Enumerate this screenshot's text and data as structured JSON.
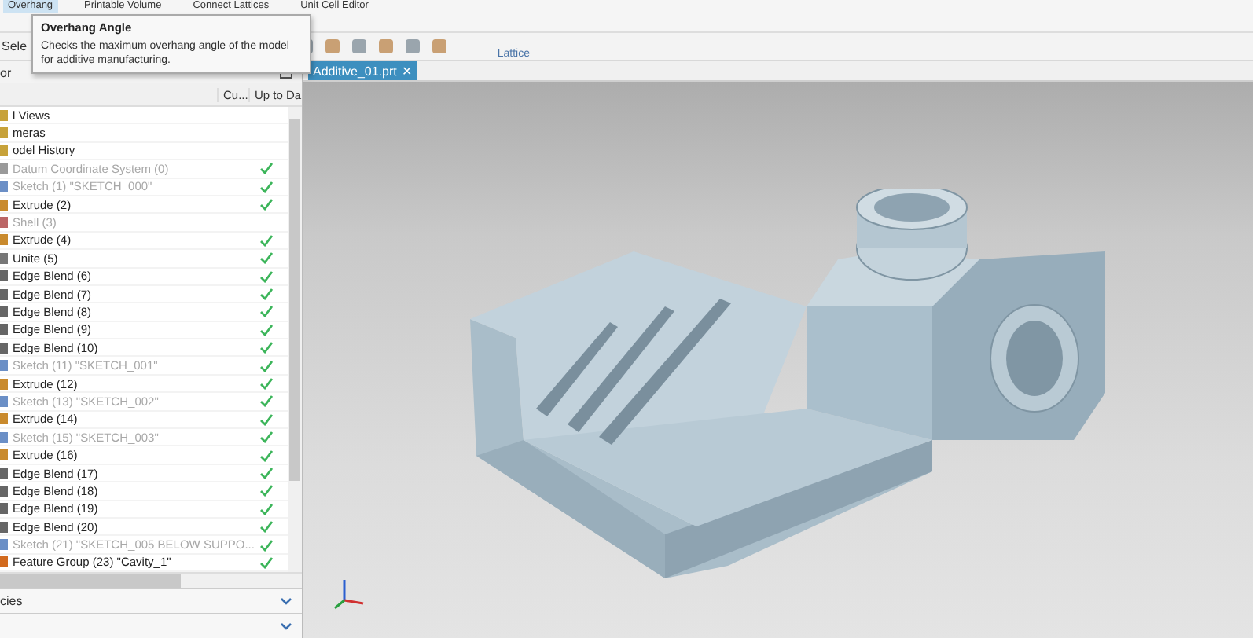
{
  "ribbon": {
    "buttons": [
      {
        "label": "Overhang"
      },
      {
        "label": "Printable Volume"
      },
      {
        "label": "Connect Lattices"
      },
      {
        "label": "Unit Cell Editor"
      }
    ],
    "group_label": "Lattice"
  },
  "tooltip": {
    "title": "Overhang Angle",
    "text": "Checks the maximum overhang angle of the model for additive manufacturing."
  },
  "toolbar": {
    "select_label": "Sele"
  },
  "document_tab": {
    "label": "Additive_01.prt",
    "selected": true,
    "close_glyph": "✕"
  },
  "navigator": {
    "title": "or",
    "columns": [
      "Cu...",
      "Up to Da"
    ],
    "rows": [
      {
        "label": "l Views",
        "kind": "folder",
        "disabled": false,
        "up_to_date": false
      },
      {
        "label": "meras",
        "kind": "folder",
        "disabled": false,
        "up_to_date": false
      },
      {
        "label": "odel History",
        "kind": "folder",
        "disabled": false,
        "up_to_date": false
      },
      {
        "label": "Datum Coordinate System (0)",
        "kind": "datum",
        "disabled": true,
        "up_to_date": true
      },
      {
        "label": "Sketch (1) \"SKETCH_000\"",
        "kind": "sketch",
        "disabled": true,
        "up_to_date": true
      },
      {
        "label": "Extrude (2)",
        "kind": "extrude",
        "disabled": false,
        "up_to_date": true
      },
      {
        "label": "Shell (3)",
        "kind": "shell",
        "disabled": true,
        "up_to_date": false
      },
      {
        "label": "Extrude (4)",
        "kind": "extrude",
        "disabled": false,
        "up_to_date": true
      },
      {
        "label": "Unite (5)",
        "kind": "unite",
        "disabled": false,
        "up_to_date": true
      },
      {
        "label": "Edge Blend (6)",
        "kind": "blend",
        "disabled": false,
        "up_to_date": true
      },
      {
        "label": "Edge Blend (7)",
        "kind": "blend",
        "disabled": false,
        "up_to_date": true
      },
      {
        "label": "Edge Blend (8)",
        "kind": "blend",
        "disabled": false,
        "up_to_date": true
      },
      {
        "label": "Edge Blend (9)",
        "kind": "blend",
        "disabled": false,
        "up_to_date": true
      },
      {
        "label": "Edge Blend (10)",
        "kind": "blend",
        "disabled": false,
        "up_to_date": true
      },
      {
        "label": "Sketch (11) \"SKETCH_001\"",
        "kind": "sketch",
        "disabled": true,
        "up_to_date": true
      },
      {
        "label": "Extrude (12)",
        "kind": "extrude",
        "disabled": false,
        "up_to_date": true
      },
      {
        "label": "Sketch (13) \"SKETCH_002\"",
        "kind": "sketch",
        "disabled": true,
        "up_to_date": true
      },
      {
        "label": "Extrude (14)",
        "kind": "extrude",
        "disabled": false,
        "up_to_date": true
      },
      {
        "label": "Sketch (15) \"SKETCH_003\"",
        "kind": "sketch",
        "disabled": true,
        "up_to_date": true
      },
      {
        "label": "Extrude (16)",
        "kind": "extrude",
        "disabled": false,
        "up_to_date": true
      },
      {
        "label": "Edge Blend (17)",
        "kind": "blend",
        "disabled": false,
        "up_to_date": true
      },
      {
        "label": "Edge Blend (18)",
        "kind": "blend",
        "disabled": false,
        "up_to_date": true
      },
      {
        "label": "Edge Blend (19)",
        "kind": "blend",
        "disabled": false,
        "up_to_date": true
      },
      {
        "label": "Edge Blend (20)",
        "kind": "blend",
        "disabled": false,
        "up_to_date": true
      },
      {
        "label": "Sketch (21) \"SKETCH_005 BELOW SUPPO...",
        "kind": "sketch",
        "disabled": true,
        "up_to_date": true
      },
      {
        "label": "Feature Group (23) \"Cavity_1\"",
        "kind": "group",
        "disabled": false,
        "up_to_date": true
      }
    ],
    "sections": [
      {
        "label": "cies",
        "expanded": false
      },
      {
        "expanded": false
      }
    ]
  }
}
